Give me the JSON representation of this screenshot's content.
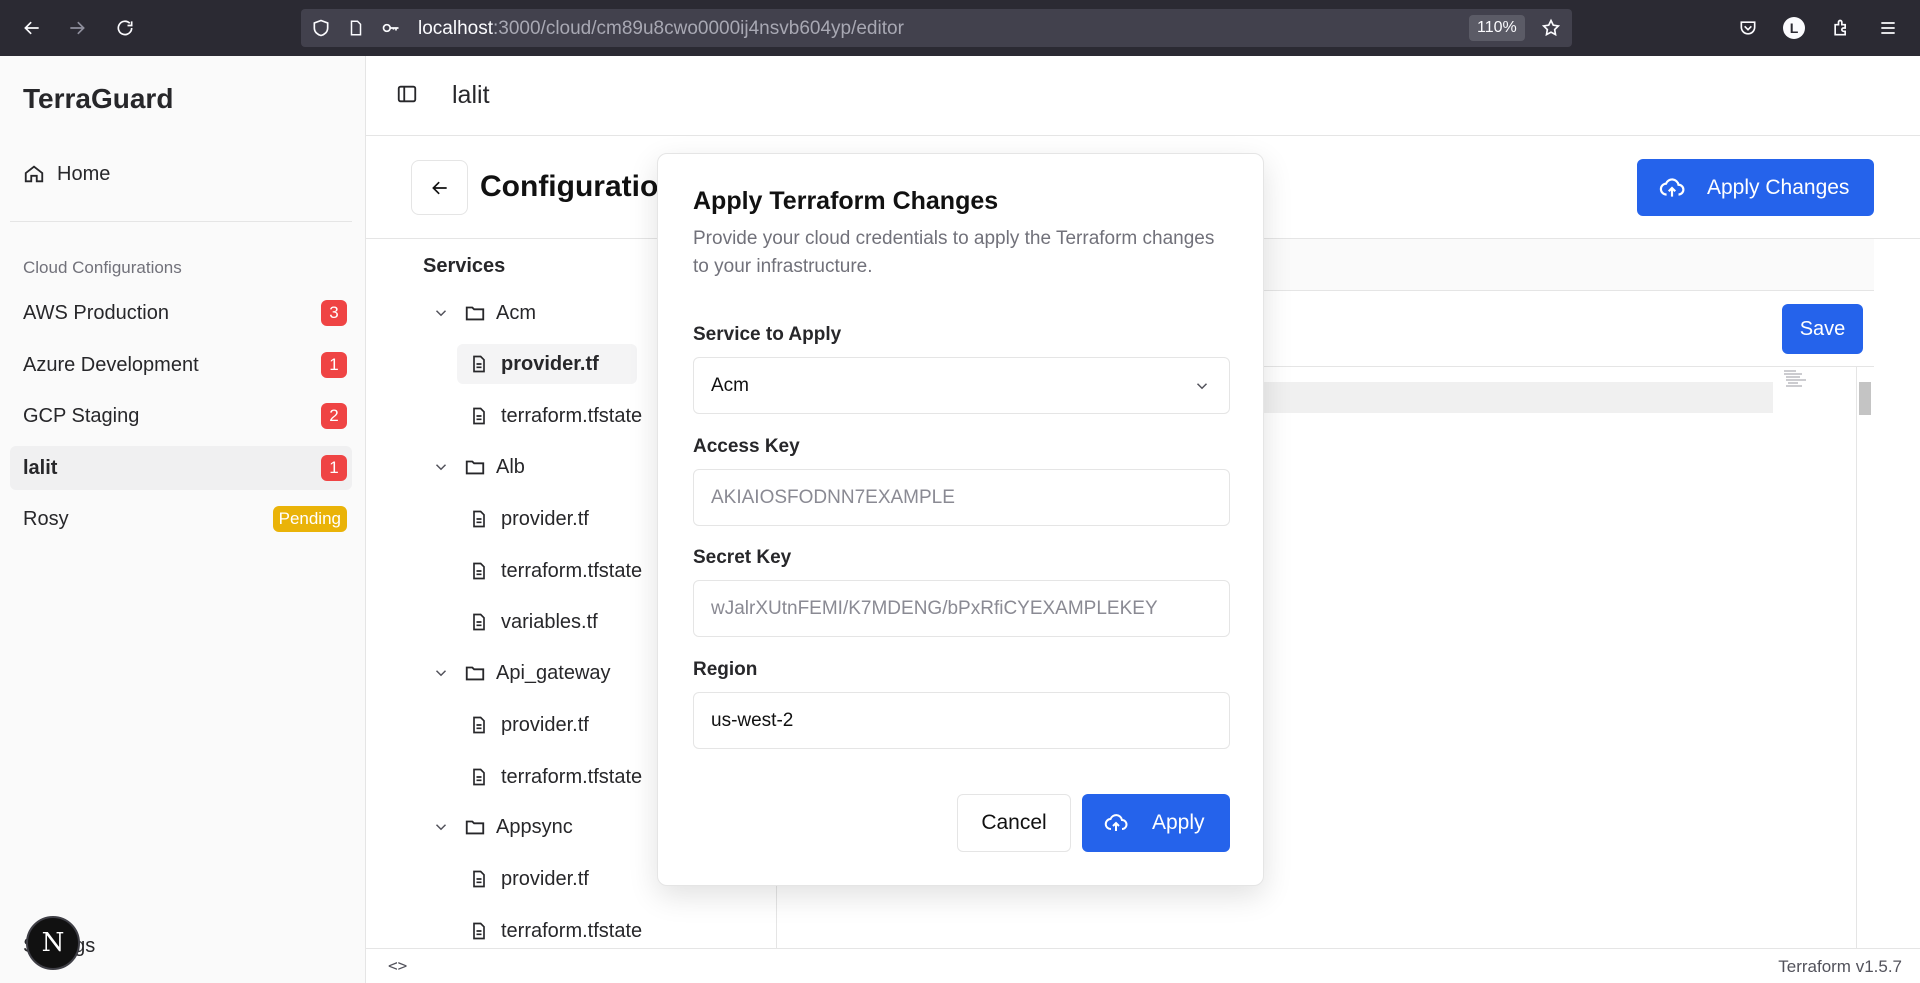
{
  "browser": {
    "url_host": "localhost",
    "url_path": ":3000/cloud/cm89u8cwo0000ij4nsvb604yp/editor",
    "zoom": "110%",
    "profile_initial": "L"
  },
  "sidebar": {
    "brand": "TerraGuard",
    "home_label": "Home",
    "group_label": "Cloud Configurations",
    "items": [
      {
        "label": "AWS Production",
        "badge": "3"
      },
      {
        "label": "Azure Development",
        "badge": "1"
      },
      {
        "label": "GCP Staging",
        "badge": "2"
      },
      {
        "label": "lalit",
        "badge": "1"
      },
      {
        "label": "Rosy",
        "badge": "Pending"
      }
    ],
    "settings_label": "Settings",
    "next_badge": "N"
  },
  "header": {
    "title": "lalit"
  },
  "page": {
    "title": "Configuration",
    "apply_changes_label": "Apply Changes",
    "save_label": "Save"
  },
  "services": {
    "heading": "Services",
    "folders": [
      {
        "name": "Acm",
        "files": [
          "provider.tf",
          "terraform.tfstate"
        ]
      },
      {
        "name": "Alb",
        "files": [
          "provider.tf",
          "terraform.tfstate",
          "variables.tf"
        ]
      },
      {
        "name": "Api_gateway",
        "files": [
          "provider.tf",
          "terraform.tfstate"
        ]
      },
      {
        "name": "Appsync",
        "files": [
          "provider.tf",
          "terraform.tfstate"
        ]
      }
    ]
  },
  "status_bar": {
    "code_toggle": "<>",
    "version": "Terraform v1.5.7"
  },
  "modal": {
    "title": "Apply Terraform Changes",
    "description": "Provide your cloud credentials to apply the Terraform changes to your infrastructure.",
    "service_label": "Service to Apply",
    "service_value": "Acm",
    "access_key_label": "Access Key",
    "access_key_placeholder": "AKIAIOSFODNN7EXAMPLE",
    "secret_key_label": "Secret Key",
    "secret_key_placeholder": "wJalrXUtnFEMI/K7MDENG/bPxRfiCYEXAMPLEKEY",
    "region_label": "Region",
    "region_value": "us-west-2",
    "cancel_label": "Cancel",
    "apply_label": "Apply"
  },
  "colors": {
    "primary": "#2563eb",
    "badge_red": "#ef4444",
    "badge_pending": "#eab308",
    "browser_chrome": "#2b2a33"
  }
}
